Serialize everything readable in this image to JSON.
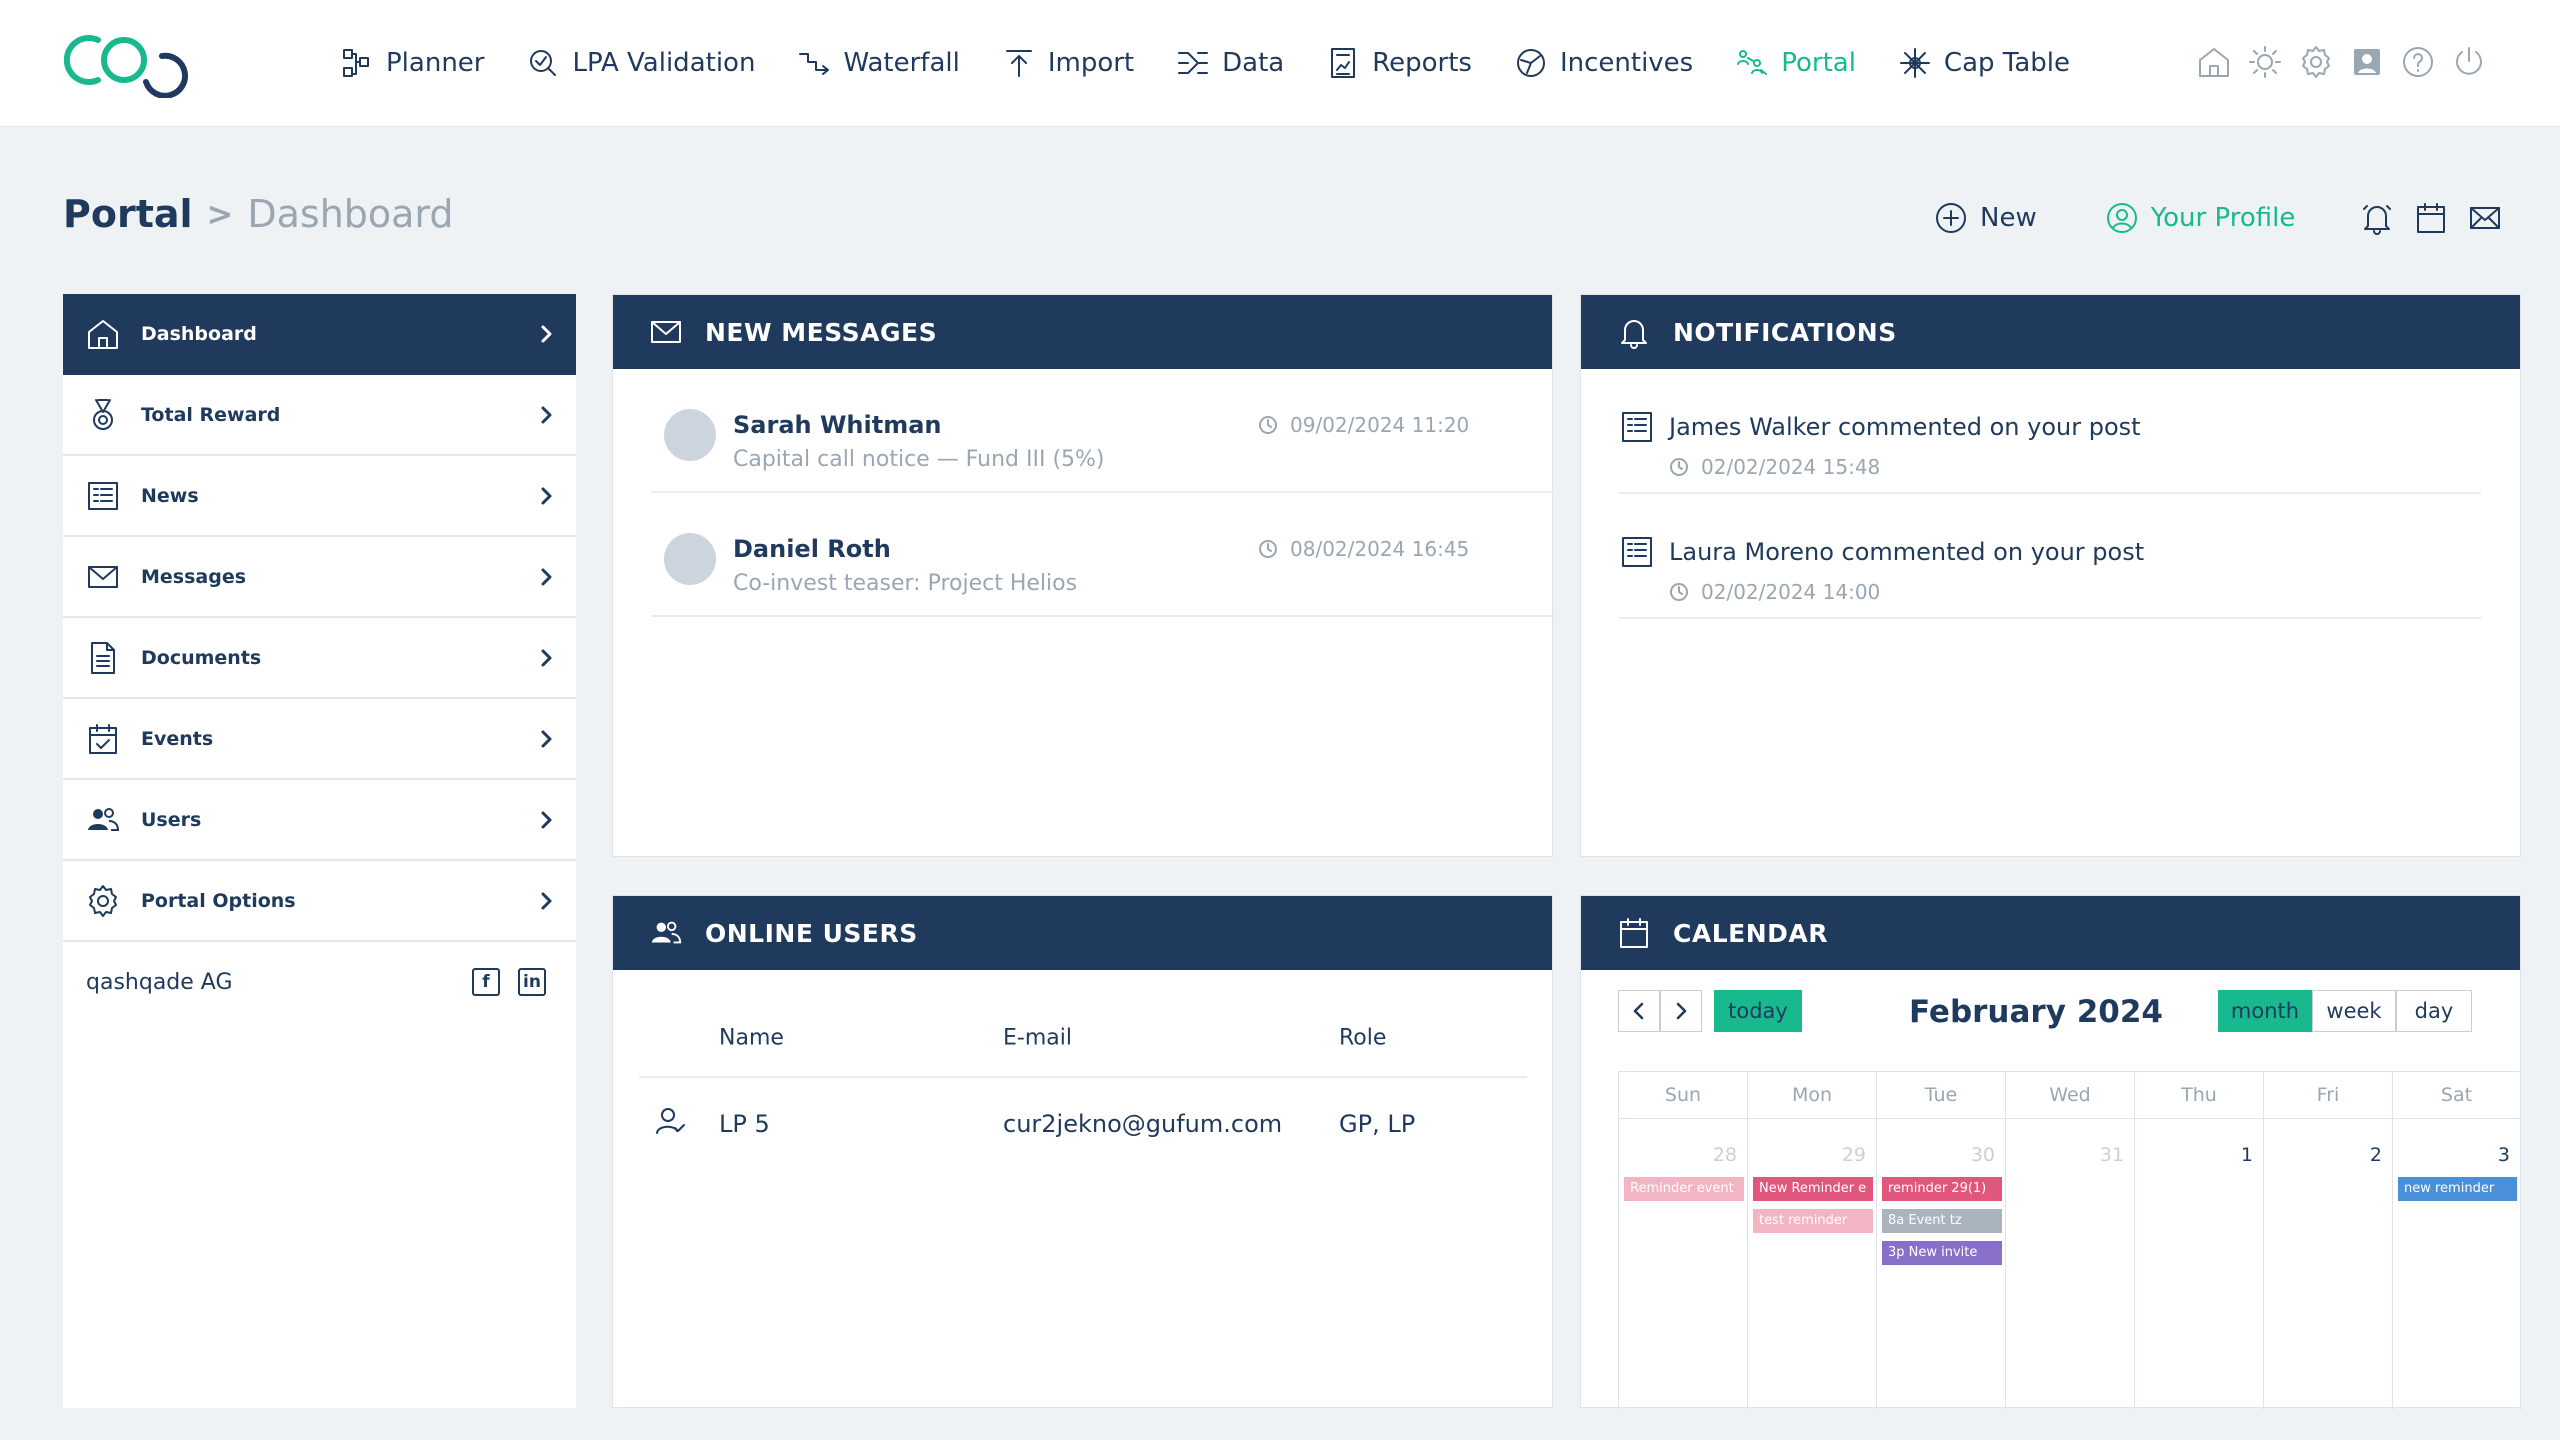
{
  "nav": {
    "items": [
      {
        "label": "Planner",
        "icon": "planner-icon"
      },
      {
        "label": "LPA Validation",
        "icon": "lpa-validation-icon"
      },
      {
        "label": "Waterfall",
        "icon": "waterfall-icon"
      },
      {
        "label": "Import",
        "icon": "import-icon"
      },
      {
        "label": "Data",
        "icon": "data-icon"
      },
      {
        "label": "Reports",
        "icon": "reports-icon"
      },
      {
        "label": "Incentives",
        "icon": "incentives-icon"
      },
      {
        "label": "Portal",
        "icon": "portal-icon",
        "active": true
      },
      {
        "label": "Cap Table",
        "icon": "cap-table-icon"
      }
    ],
    "utility_icons": [
      "home-icon",
      "sun-icon",
      "gear-icon",
      "contact-card-icon",
      "help-icon",
      "power-icon"
    ]
  },
  "breadcrumb": {
    "root": "Portal",
    "separator": ">",
    "current": "Dashboard"
  },
  "actions": {
    "new_label": "New",
    "profile_label": "Your Profile",
    "icons": [
      "bell-icon",
      "calendar-icon",
      "mail-icon"
    ]
  },
  "sidebar": {
    "items": [
      {
        "label": "Dashboard",
        "icon": "home-icon",
        "active": true
      },
      {
        "label": "Total Reward",
        "icon": "medal-icon"
      },
      {
        "label": "News",
        "icon": "news-icon"
      },
      {
        "label": "Messages",
        "icon": "mail-icon"
      },
      {
        "label": "Documents",
        "icon": "document-icon"
      },
      {
        "label": "Events",
        "icon": "calendar-check-icon"
      },
      {
        "label": "Users",
        "icon": "users-icon"
      },
      {
        "label": "Portal Options",
        "icon": "gear-icon"
      }
    ],
    "company": "qashqade AG",
    "social": [
      {
        "name": "facebook-icon",
        "glyph": "f"
      },
      {
        "name": "linkedin-icon",
        "glyph": "in"
      }
    ]
  },
  "messages": {
    "title": "NEW MESSAGES",
    "items": [
      {
        "name": "Sarah Whitman",
        "subject": "Capital call notice — Fund III (5%)",
        "time": "09/02/2024 11:20"
      },
      {
        "name": "Daniel Roth",
        "subject": "Co-invest teaser: Project Helios",
        "time": "08/02/2024 16:45"
      }
    ]
  },
  "notifications": {
    "title": "NOTIFICATIONS",
    "items": [
      {
        "text": "James Walker commented on your post",
        "time": "02/02/2024 15:48"
      },
      {
        "text": "Laura Moreno commented on your post",
        "time": "02/02/2024 14:00"
      }
    ]
  },
  "online_users": {
    "title": "ONLINE USERS",
    "columns": [
      "Name",
      "E-mail",
      "Role"
    ],
    "rows": [
      {
        "name": "LP 5",
        "email": "cur2jekno@gufum.com",
        "role": "GP, LP"
      }
    ]
  },
  "calendar": {
    "title": "CALENDAR",
    "month": "February 2024",
    "today_label": "today",
    "views": [
      "month",
      "week",
      "day"
    ],
    "active_view": "month",
    "weekdays": [
      "Sun",
      "Mon",
      "Tue",
      "Wed",
      "Thu",
      "Fri",
      "Sat"
    ],
    "days": [
      {
        "num": "28",
        "other": true,
        "events": [
          {
            "label": "Reminder event",
            "color": "#f3b4c4"
          }
        ]
      },
      {
        "num": "29",
        "other": true,
        "events": [
          {
            "label": "New Reminder e",
            "color": "#e0567d"
          },
          {
            "label": "test reminder",
            "color": "#f3b4c4"
          }
        ]
      },
      {
        "num": "30",
        "other": true,
        "events": [
          {
            "label": "reminder 29(1)",
            "color": "#e0567d"
          },
          {
            "label": "8a Event tz",
            "color": "#a9b4bf"
          },
          {
            "label": "3p New invite",
            "color": "#8a6fc8"
          }
        ]
      },
      {
        "num": "31",
        "other": true,
        "events": []
      },
      {
        "num": "1",
        "other": false,
        "events": []
      },
      {
        "num": "2",
        "other": false,
        "events": []
      },
      {
        "num": "3",
        "other": false,
        "events": [
          {
            "label": "new reminder",
            "color": "#4a90d9"
          }
        ]
      }
    ]
  },
  "colors": {
    "navy": "#1f3a5c",
    "accent": "#19b98f",
    "muted": "#9aa6b2",
    "background": "#eef2f5"
  }
}
